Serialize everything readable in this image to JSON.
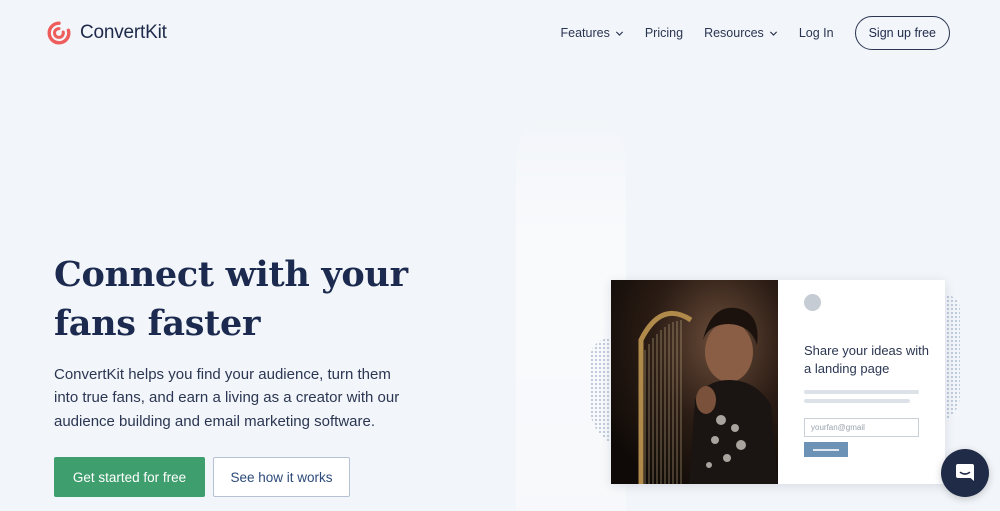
{
  "brand": {
    "name": "ConvertKit",
    "logo_icon": "convertkit-swirl-icon",
    "accent": "#ef5c5c"
  },
  "nav": {
    "items": [
      {
        "label": "Features",
        "has_dropdown": true
      },
      {
        "label": "Pricing",
        "has_dropdown": false
      },
      {
        "label": "Resources",
        "has_dropdown": true
      },
      {
        "label": "Log In",
        "has_dropdown": false
      }
    ],
    "signup_label": "Sign up free"
  },
  "hero": {
    "headline": "Connect with your fans faster",
    "subtext": "ConvertKit helps you find your audience, turn them into true fans, and earn a living as a creator with our audience building and email marketing software.",
    "primary_cta": "Get started for free",
    "secondary_cta": "See how it works",
    "primary_color": "#3f9e6d"
  },
  "preview": {
    "title": "Share your ideas with a landing page",
    "email_placeholder": "yourfan@gmail"
  },
  "chat": {
    "icon": "chat-bubble-icon",
    "color": "#1f2b47"
  }
}
